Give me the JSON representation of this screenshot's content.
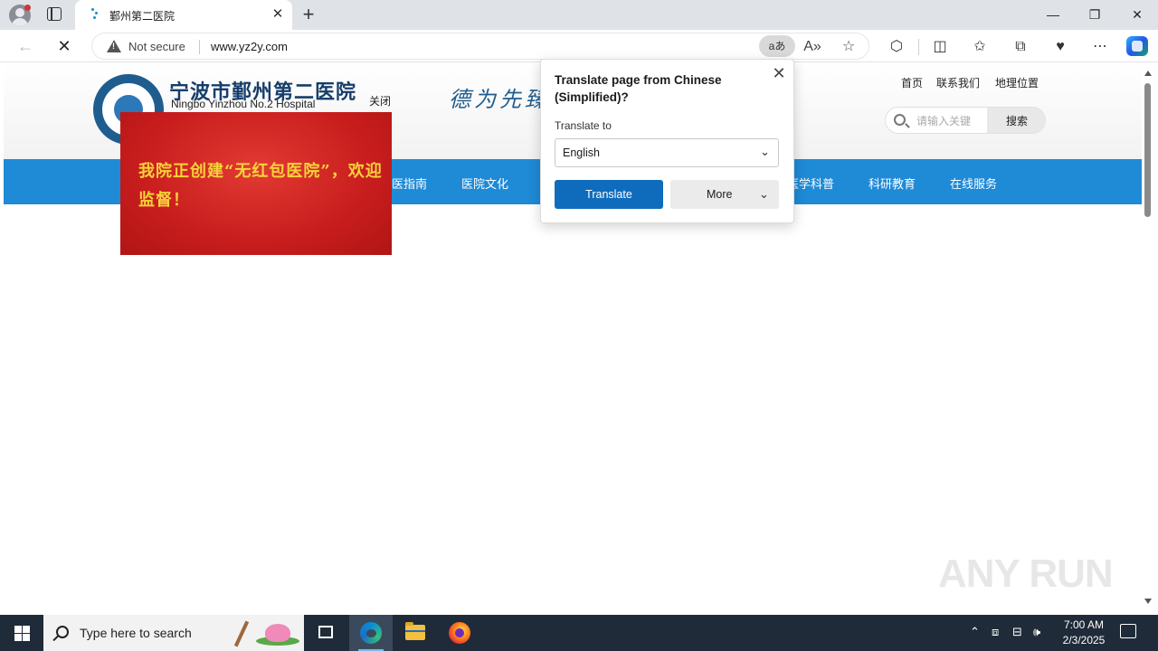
{
  "browser": {
    "tab": {
      "title": "鄞州第二医院",
      "close_glyph": "✕"
    },
    "new_tab_glyph": "+",
    "window_controls": {
      "minimize": "—",
      "maximize": "❐",
      "close": "✕"
    },
    "nav": {
      "back": "←",
      "stop": "✕"
    },
    "address_bar": {
      "security_label": "Not secure",
      "url": "www.yz2y.com",
      "translate_glyph": "aあ",
      "read_aloud_glyph": "A»",
      "favorite_glyph": "☆"
    },
    "toolbar_icons": [
      "extensions-icon",
      "split-screen-icon",
      "favorites-icon",
      "collections-icon",
      "browser-essentials-icon",
      "more-icon",
      "copilot-icon"
    ],
    "toolbar_glyphs": {
      "extensions": "⬡",
      "split": "◫",
      "favorites": "✩",
      "collections": "⧉",
      "essentials": "♥",
      "more": "⋯"
    }
  },
  "page": {
    "hospital_name_cn": "宁波市鄞州第二医院",
    "hospital_name_en": "Ningbo Yinzhou No.2 Hospital",
    "close_label": "关闭",
    "calligraphy": "德为先臻",
    "top_links": [
      "首页",
      "联系我们",
      "地理位置"
    ],
    "search": {
      "placeholder": "请输入关键",
      "button": "搜索"
    },
    "nav_items": [
      "医指南",
      "医院文化",
      "医学科普",
      "科研教育",
      "在线服务"
    ],
    "popup_ad_text": "我院正创建“无红包医院”，欢迎监督！"
  },
  "translate_popup": {
    "title": "Translate page from Chinese (Simplified)?",
    "translate_to_label": "Translate to",
    "selected_language": "English",
    "translate_button": "Translate",
    "more_button": "More",
    "close_glyph": "✕",
    "chevron_glyph": "⌄"
  },
  "watermark": "ANY RUN",
  "taskbar": {
    "search_placeholder": "Type here to search",
    "tray_glyphs": {
      "chevron": "⌃",
      "meet": "⧈",
      "network": "⊟",
      "volume": "🕪"
    },
    "time": "7:00 AM",
    "date": "2/3/2025"
  },
  "colors": {
    "nav_blue": "#1f8ad6",
    "translate_blue": "#0f6cbd",
    "ad_red": "#c81d1d",
    "ad_text_yellow": "#f6d23a",
    "taskbar": "#1f2b38"
  }
}
